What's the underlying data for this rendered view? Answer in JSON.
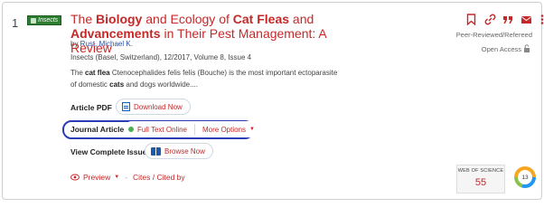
{
  "result": {
    "number": "1",
    "journal_thumb_text": "Insects",
    "title_parts": {
      "t1": "The ",
      "t2": "Biology",
      "t3": " and Ecology of ",
      "t4": "Cat Fleas",
      "t5": " and ",
      "t6": "Advancements",
      "t7": " in Their Pest Management: A Review"
    },
    "authors_prefix": "by ",
    "author": "Rust, Michael K.",
    "source": "Insects (Basel, Switzerland), 12/2017, Volume 8, Issue 4",
    "snippet_parts": {
      "s1": "The ",
      "s2": "cat flea",
      "s3": " Ctenocephalides felis felis (Bouche) is the most important ectoparasite of domestic ",
      "s4": "cats",
      "s5": " and dogs worldwide...."
    }
  },
  "article_pdf": {
    "label": "Article PDF",
    "button": "Download Now"
  },
  "journal_article": {
    "label": "Journal Article",
    "full_text": "Full Text Online",
    "more_options": "More Options"
  },
  "complete_issue": {
    "label": "View Complete Issue",
    "button": "Browse Now"
  },
  "actions": {
    "preview": "Preview",
    "cites": "Cites / Cited by"
  },
  "side": {
    "peer_reviewed": "Peer-Reviewed/Refereed",
    "open_access": "Open Access",
    "wos_label": "WEB OF SCIENCE",
    "wos_count": "55",
    "altmetric_score": "13"
  },
  "colors": {
    "accent_red": "#c62828",
    "link_blue": "#2a4fa8",
    "highlight": "#2a3db5",
    "online_green": "#4caf50"
  }
}
